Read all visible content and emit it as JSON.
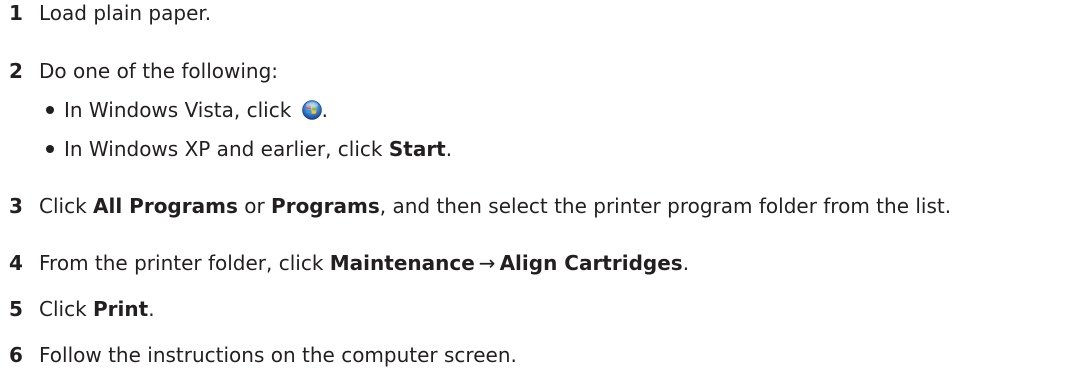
{
  "steps": [
    {
      "num": "1",
      "text": "Load plain paper."
    },
    {
      "num": "2",
      "text": "Do one of the following:"
    },
    {
      "num": "3",
      "pre": "Click ",
      "bold1": "All Programs",
      "mid": " or ",
      "bold2": "Programs",
      "post": ", and then select the printer program folder from the list."
    },
    {
      "num": "4",
      "pre": "From the printer folder, click ",
      "bold1": "Maintenance",
      "arrow": "→",
      "bold2": "Align Cartridges",
      "post": "."
    },
    {
      "num": "5",
      "pre": "Click ",
      "bold": "Print",
      "post": "."
    },
    {
      "num": "6",
      "text": "Follow the instructions on the computer screen."
    }
  ],
  "substeps": [
    {
      "pre": "In Windows Vista, click ",
      "icon": "windows-vista-start-icon",
      "post": "."
    },
    {
      "pre": "In Windows XP and earlier, click ",
      "bold": "Start",
      "post": "."
    }
  ],
  "colors": {
    "text": "#231f20"
  }
}
